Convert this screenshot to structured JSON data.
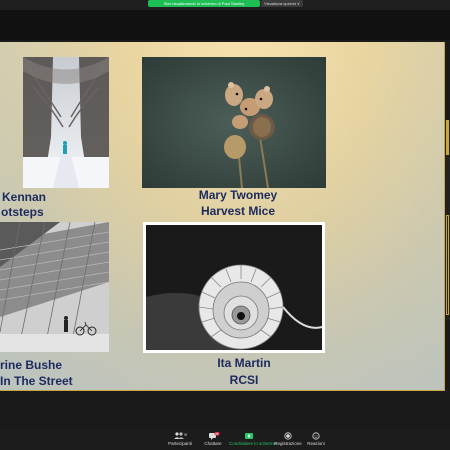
{
  "topbar": {
    "sharing_notice": "Stai visualizzando lo schermo di Paul Stanley",
    "view_options": "Visualizza opzioni ∨"
  },
  "slide": {
    "entries": [
      {
        "author": "Kennan",
        "title": "otsteps"
      },
      {
        "author": "Mary Twomey",
        "title": "Harvest Mice"
      },
      {
        "author": "rine Bushe",
        "title": "In The Street"
      },
      {
        "author": "Ita Martin",
        "title": "RCSI"
      }
    ]
  },
  "toolbar": {
    "participants_label": "Partecipanti",
    "participants_count": "95",
    "chat_label": "Chattare",
    "chat_badge": "25",
    "share_label": "Condividere lo schermo",
    "record_label": "Registrazione",
    "reactions_label": "Reazioni"
  },
  "colors": {
    "share_green": "#1dbf55",
    "caption_navy": "#1c2a5e",
    "slide_border": "#c9a644"
  }
}
